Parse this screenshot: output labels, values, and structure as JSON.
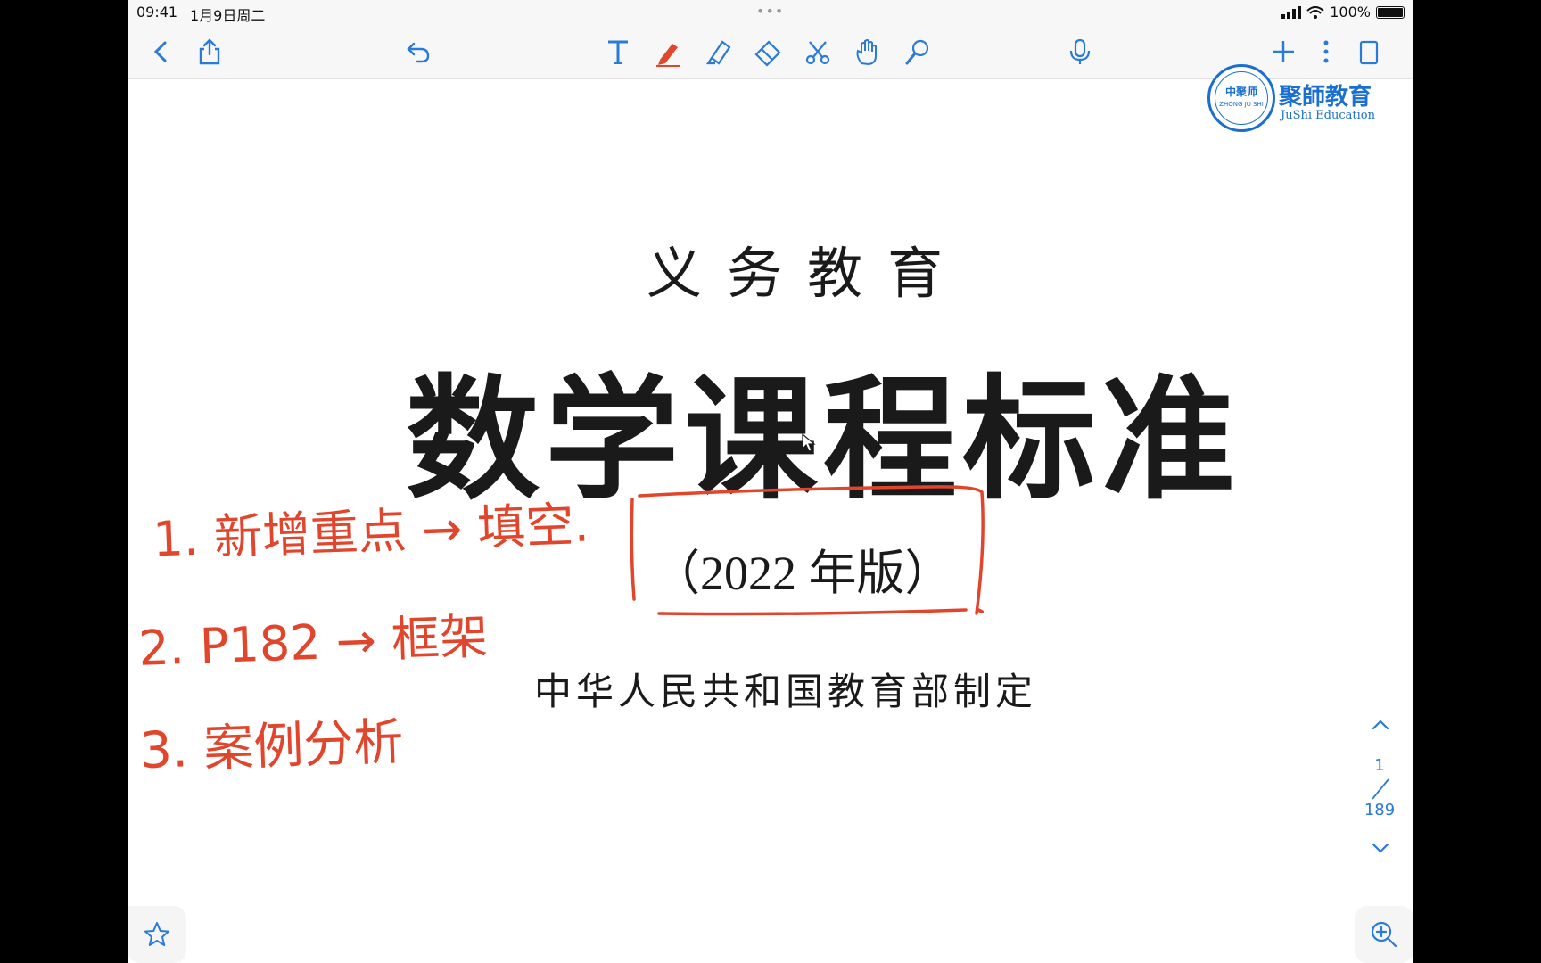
{
  "status_bar": {
    "time": "09:41",
    "date": "1月9日周二",
    "dots": "•••",
    "battery": "100%"
  },
  "toolbar": {
    "icons": [
      "back-icon",
      "share-icon",
      "undo-icon",
      "text-tool-icon",
      "pen-tool-icon",
      "highlighter-tool-icon",
      "eraser-tool-icon",
      "lasso-scissors-icon",
      "hand-tool-icon",
      "laser-pointer-icon",
      "microphone-icon",
      "add-page-icon",
      "more-icon",
      "page-layout-icon"
    ],
    "accent": "#2a7ad8",
    "pen_color": "#e1452c"
  },
  "logo": {
    "seal_text": "中聚师",
    "seal_sub": "ZHONG JU SHI",
    "name_cn": "聚師教育",
    "name_en": "JuShi Education",
    "color": "#1a6fd0"
  },
  "document": {
    "subtitle": "义务教育",
    "title": "数学课程标准",
    "edition": "（2022 年版）",
    "issuer": "中华人民共和国教育部制定"
  },
  "annotations": {
    "color": "#e1452c",
    "note1": "1. 新增重点 → 填空.",
    "note2": "2.  P182 → 框架",
    "note3": "3.  案例分析"
  },
  "pager": {
    "current": "1",
    "total": "189"
  }
}
